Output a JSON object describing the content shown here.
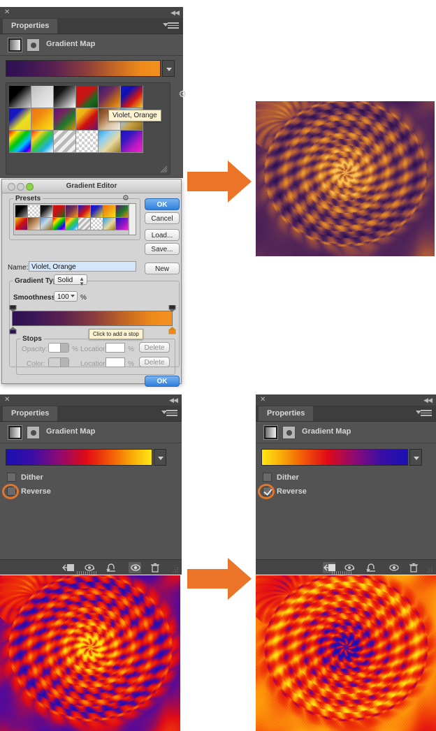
{
  "app": "Adobe Photoshop — Gradient Map adjustment",
  "panels": {
    "top_properties": {
      "close_icon": "close-icon",
      "collapse_icon": "collapse-panel-icon",
      "tab_label": "Properties",
      "menu_icon": "panel-menu-icon",
      "adjustment_title": "Gradient Map",
      "adjustment_icon": "gradient-map-icon",
      "mask_icon": "layer-mask-icon",
      "gradient_preview": {
        "from": "#2E1052",
        "to": "#F2891C",
        "name": "Violet, Orange"
      },
      "dropdown_icon": "chevron-down-icon",
      "gear_icon": "preset-options-gear-icon",
      "tooltip": "Violet, Orange",
      "presets": [
        [
          "#171717",
          "#c8c8c8",
          "#141414",
          "#c81414",
          "#3b1a6e",
          "#1414c8"
        ],
        [
          "#1414c8",
          "#f09010",
          "#5a1470",
          "#f0c814",
          "#7a4a28",
          "#b7cbe0"
        ],
        [
          "#ff00ff",
          "#ff2222",
          "#bdbdbd",
          "#cfcfcf",
          "#2aa0e6",
          "#1a10c8"
        ]
      ]
    },
    "gradient_editor": {
      "window_title": "Gradient Editor",
      "traffic_lights": [
        "#c9c9c9",
        "#c9c9c9",
        "#8dd24a"
      ],
      "presets_group_label": "Presets",
      "gear_icon": "preset-options-gear-icon",
      "buttons": [
        "OK",
        "Cancel",
        "Load...",
        "Save...",
        "New"
      ],
      "name_label": "Name:",
      "name_value": "Violet, Orange",
      "gradient_type_label": "Gradient Type:",
      "gradient_type_value": "Solid",
      "smoothness_label": "Smoothness:",
      "smoothness_value": "100",
      "smoothness_unit": "%",
      "editor_gradient": {
        "from": "#2E1052",
        "to": "#F2891C"
      },
      "tooltip": "Click to add a stop",
      "stops_group_label": "Stops",
      "opacity_label": "Opacity:",
      "opacity_value": "",
      "opacity_unit": "%",
      "color_label": "Color:",
      "location_label": "Location:",
      "location_value": "",
      "location_unit": "%",
      "delete_label": "Delete",
      "left_stop_color": "#2E1052",
      "right_stop_color": "#F2891C"
    },
    "bottom_left_properties": {
      "close_icon": "close-icon",
      "collapse_icon": "collapse-panel-icon",
      "tab_label": "Properties",
      "menu_icon": "panel-menu-icon",
      "adjustment_title": "Gradient Map",
      "adjustment_icon": "gradient-map-icon",
      "mask_icon": "layer-mask-icon",
      "gradient_preview": {
        "name": "Blue, Red, Yellow",
        "reversed": false
      },
      "dropdown_icon": "chevron-down-icon",
      "dither_label": "Dither",
      "dither_checked": false,
      "reverse_label": "Reverse",
      "reverse_checked": false,
      "highlight_color": "#e0762c",
      "footer_icons": [
        "clip-to-layer-icon",
        "view-previous-state-icon",
        "reset-icon",
        "toggle-visibility-icon",
        "delete-icon"
      ]
    },
    "bottom_right_properties": {
      "close_icon": "close-icon",
      "collapse_icon": "collapse-panel-icon",
      "tab_label": "Properties",
      "menu_icon": "panel-menu-icon",
      "adjustment_title": "Gradient Map",
      "adjustment_icon": "gradient-map-icon",
      "mask_icon": "layer-mask-icon",
      "gradient_preview": {
        "name": "Blue, Red, Yellow",
        "reversed": true
      },
      "dropdown_icon": "chevron-down-icon",
      "dither_label": "Dither",
      "dither_checked": false,
      "reverse_label": "Reverse",
      "reverse_checked": true,
      "highlight_color": "#e0762c",
      "footer_icons": [
        "clip-to-layer-icon",
        "view-previous-state-icon",
        "reset-icon",
        "toggle-visibility-icon",
        "delete-icon"
      ]
    }
  },
  "arrows": {
    "color": "#EC7428",
    "top": "arrow-right-icon",
    "bottom": "arrow-right-icon"
  },
  "images": {
    "top_right": {
      "name": "dahlia-violet-orange-result",
      "palette": [
        "#3a1a55",
        "#8a3a52",
        "#d2701e",
        "#f6b040"
      ]
    },
    "bottom_left": {
      "name": "dahlia-blue-red-yellow-result",
      "palette": [
        "#1a10a8",
        "#e61010",
        "#ff8c00",
        "#ffe020"
      ]
    },
    "bottom_right": {
      "name": "dahlia-reversed-result",
      "palette": [
        "#ffe020",
        "#ff8c00",
        "#e61010",
        "#1a10a8"
      ]
    }
  }
}
